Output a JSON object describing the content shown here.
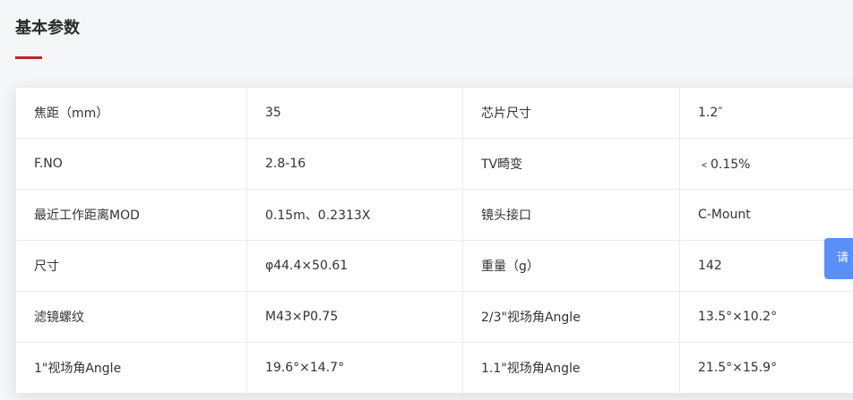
{
  "section": {
    "title": "基本参数",
    "accent_color": "#b3282d"
  },
  "params": {
    "rows": [
      {
        "label1": "焦距（mm）",
        "value1": "35",
        "label2": "芯片尺寸",
        "value2": "1.2″"
      },
      {
        "label1": "F.NO",
        "value1": "2.8-16",
        "label2": "TV畸变",
        "value2": "﹤0.15%"
      },
      {
        "label1": "最近工作距离MOD",
        "value1": "0.15m、0.2313X",
        "label2": "镜头接口",
        "value2": "C-Mount"
      },
      {
        "label1": "尺寸",
        "value1": "φ44.4×50.61",
        "label2": "重量（g）",
        "value2": "142"
      },
      {
        "label1": "滤镜螺纹",
        "value1": "M43×P0.75",
        "label2": "2/3\"视场角Angle",
        "value2": "13.5°×10.2°"
      },
      {
        "label1": "1\"视场角Angle",
        "value1": "19.6°×14.7°",
        "label2": "1.1\"视场角Angle",
        "value2": "21.5°×15.9°"
      }
    ]
  },
  "floating_button": {
    "label": "请",
    "color": "#5b8ff9"
  }
}
